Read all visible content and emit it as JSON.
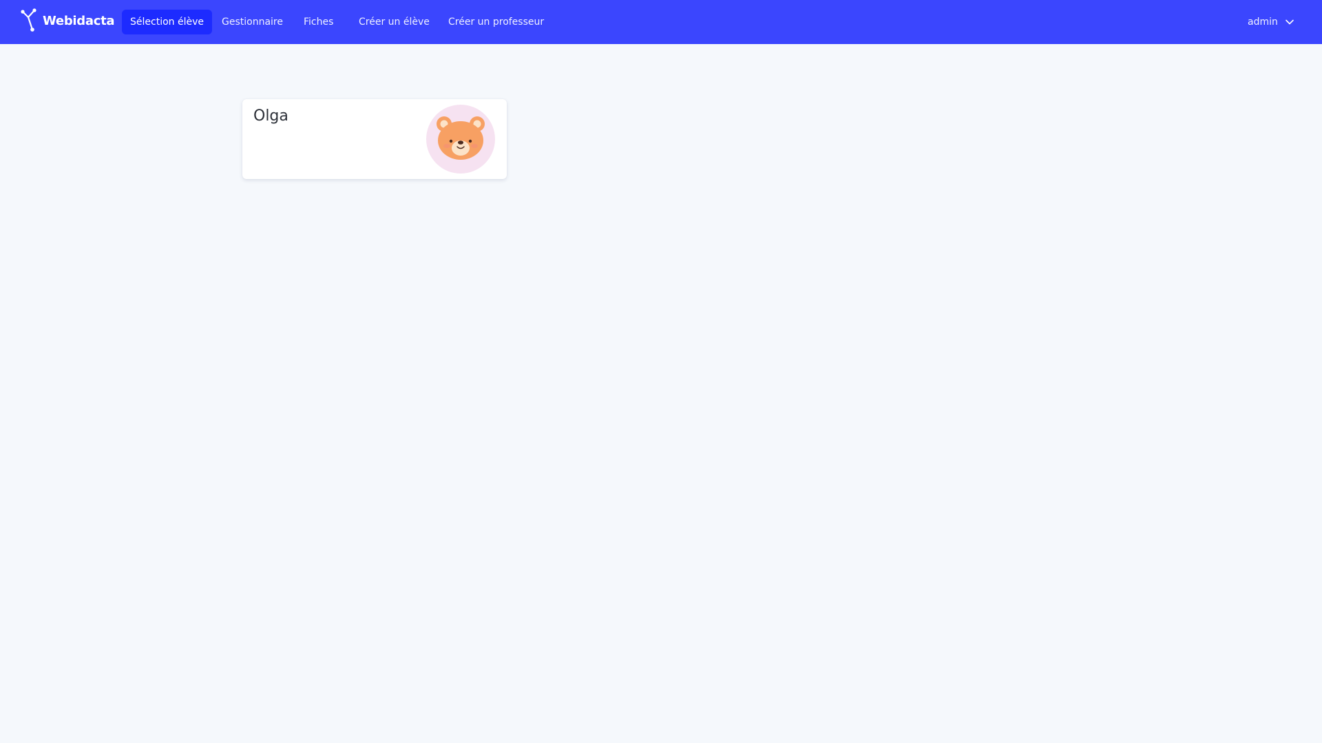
{
  "app": {
    "brand_name": "Webidacta",
    "brand_icon": "network-nodes-icon"
  },
  "nav": {
    "items": [
      {
        "label": "Sélection élève",
        "active": true
      },
      {
        "label": "Gestionnaire",
        "active": false
      },
      {
        "label": "Fiches",
        "active": false
      },
      {
        "label": "Créer un élève",
        "active": false
      },
      {
        "label": "Créer un professeur",
        "active": false
      }
    ]
  },
  "user": {
    "name": "admin",
    "icon": "chevron-down-icon"
  },
  "students": [
    {
      "name": "Olga",
      "avatar": "bear-face-icon"
    }
  ],
  "colors": {
    "navbar": "#3b46fe",
    "nav_active": "#1d2bff",
    "page_background": "#f5f8fc",
    "avatar_background": "#f6e2f1",
    "bear": "#f7a063"
  }
}
